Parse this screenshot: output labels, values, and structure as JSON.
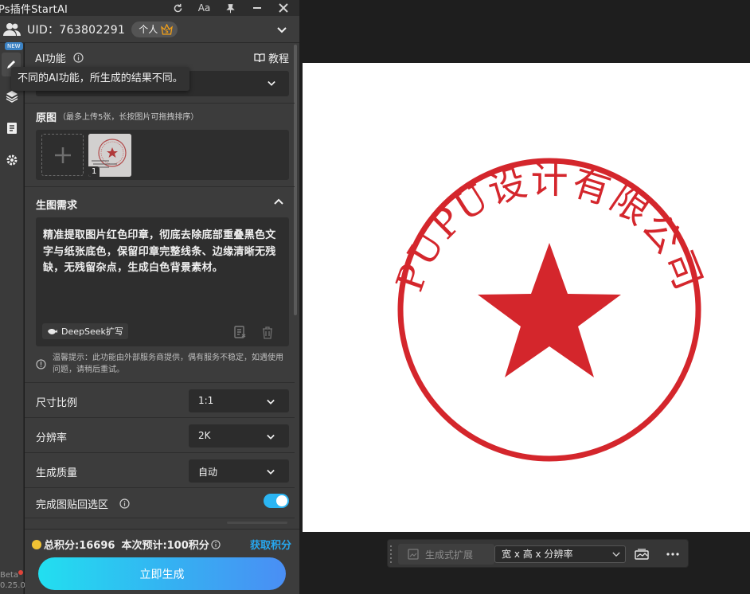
{
  "app": {
    "title": "Ps插件StartAI",
    "toolbar_text_label": "Aa"
  },
  "account": {
    "uid_label": "UID：763802291",
    "plan": "个人",
    "plan_badge": "S"
  },
  "ai_feature": {
    "label": "AI功能",
    "tutorial": "教程",
    "tooltip": "不同的AI功能，所生成的结果不同。",
    "new_badge": "NEW"
  },
  "source": {
    "label": "原图",
    "note": "（最多上传5张，长按图片可拖拽排序）",
    "thumb_index": "1"
  },
  "requirement": {
    "label": "生图需求",
    "prompt": "精准提取图片红色印章，彻底去除底部重叠黑色文字与纸张底色，保留印章完整线条、边缘清晰无残缺，无残留杂点，生成白色背景素材。",
    "deepseek_label": "DeepSeek扩写",
    "hint": "温馨提示：此功能由外部服务商提供，偶有服务不稳定，如遇使用问题，请稍后重试。"
  },
  "options": {
    "ratio": {
      "label": "尺寸比例",
      "value": "1:1"
    },
    "resolution": {
      "label": "分辨率",
      "value": "2K"
    },
    "quality": {
      "label": "生成质量",
      "value": "自动"
    },
    "paste_back": {
      "label": "完成图贴回选区",
      "enabled": true
    }
  },
  "footer": {
    "points_total": "总积分:16696",
    "points_estimate": "本次预计:100积分",
    "get_points": "获取积分",
    "generate": "立即生成",
    "beta_label": "Beta",
    "version": "0.25.0"
  },
  "stamp": {
    "ring_text": "PUPU设计有限公司",
    "color": "#d4262c"
  },
  "context_bar": {
    "generative_expand": "生成式扩展",
    "size_select": "宽 x 高 x 分辨率"
  },
  "colors": {
    "accent": "#27a7ee",
    "panel_bg": "#3c3c3c",
    "toggle_on": "#2bb5f3"
  }
}
